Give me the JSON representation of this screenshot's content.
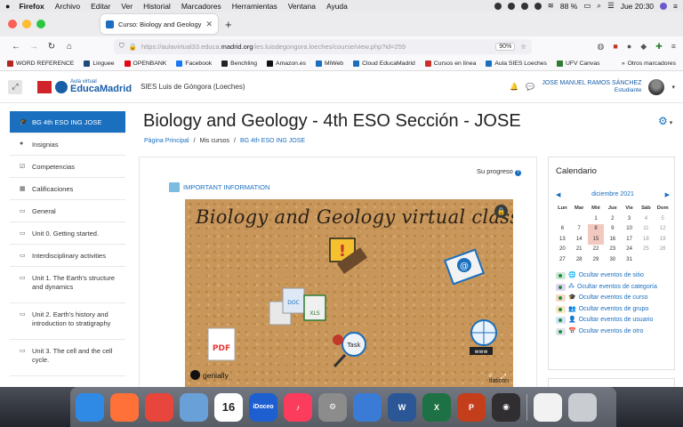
{
  "menubar": {
    "app": "Firefox",
    "items": [
      "Archivo",
      "Editar",
      "Ver",
      "Historial",
      "Marcadores",
      "Herramientas",
      "Ventana",
      "Ayuda"
    ],
    "battery": "88 %",
    "clock": "Jue 20:30"
  },
  "tab": {
    "title": "Curso: Biology and Geology - 4..."
  },
  "navbar": {
    "url_prefix": "https://aulavirtual33.educa.",
    "url_domain": "madrid.org",
    "url_suffix": "/ies.luisdegongora.loeches/course/view.php?id=259",
    "zoom": "90%"
  },
  "bookmarks": [
    {
      "label": "WORD REFERENCE",
      "color": "#b3261e"
    },
    {
      "label": "Linguee",
      "color": "#1e4a7a"
    },
    {
      "label": "OPENBANK",
      "color": "#e30613"
    },
    {
      "label": "Facebook",
      "color": "#1877f2"
    },
    {
      "label": "Benchling",
      "color": "#222222"
    },
    {
      "label": "Amazon.es",
      "color": "#111111"
    },
    {
      "label": "MiWeb",
      "color": "#1a6fbf"
    },
    {
      "label": "Cloud EducaMadrid",
      "color": "#1a6fbf"
    },
    {
      "label": "Cursos en línea",
      "color": "#c9302c"
    },
    {
      "label": "Aula SIES Loeches",
      "color": "#1a6fbf"
    },
    {
      "label": "UFV Canvas",
      "color": "#2e7d32"
    }
  ],
  "bookmarks_more": "Otros marcadores",
  "header": {
    "logo_small": "Aula virtual",
    "logo_big": "EducaMadrid",
    "school": "SIES Luis de Góngora (Loeches)",
    "user_name": "JOSE MANUEL RAMOS SÁNCHEZ",
    "user_role": "Estudiante"
  },
  "leftnav": [
    {
      "label": "BG 4th ESO ING JOSE",
      "icon": "graduation-cap-icon",
      "glyph": "🎓"
    },
    {
      "label": "Insignias",
      "icon": "badge-icon",
      "glyph": "●"
    },
    {
      "label": "Competencias",
      "icon": "check-icon",
      "glyph": "☑"
    },
    {
      "label": "Calificaciones",
      "icon": "table-icon",
      "glyph": "▦"
    },
    {
      "label": "General",
      "icon": "folder-icon",
      "glyph": "▭"
    },
    {
      "label": "Unit 0. Getting started.",
      "icon": "folder-icon",
      "glyph": "▭"
    },
    {
      "label": "Interdisciplinary activities",
      "icon": "folder-icon",
      "glyph": "▭"
    },
    {
      "label": "Unit 1. The Earth's structure and dynamics",
      "icon": "folder-icon",
      "glyph": "▭"
    },
    {
      "label": "Unit 2. Earth's history and introduction to stratigraphy",
      "icon": "folder-icon",
      "glyph": "▭"
    },
    {
      "label": "Unit 3. The cell and the cell cycle.",
      "icon": "folder-icon",
      "glyph": "▭"
    }
  ],
  "main": {
    "title": "Biology and Geology - 4th ESO Sección - JOSE",
    "breadcrumb": [
      "Página Principal",
      "Mis cursos",
      "BG 4th ESO ING JOSE"
    ],
    "progress": "Su progreso",
    "info_link": "IMPORTANT INFORMATION",
    "genially_title": "Biology and Geology virtual class",
    "genially_logo": "genially",
    "flaticon": "flaticon"
  },
  "calendar": {
    "title": "Calendario",
    "month": "diciembre 2021",
    "weekdays": [
      "Lun",
      "Mar",
      "Mié",
      "Jue",
      "Vie",
      "Sáb",
      "Dom"
    ],
    "weeks": [
      [
        "",
        "",
        "1",
        "2",
        "3",
        "4",
        "5"
      ],
      [
        "6",
        "7",
        "8",
        "9",
        "10",
        "11",
        "12"
      ],
      [
        "13",
        "14",
        "15",
        "16",
        "17",
        "18",
        "19"
      ],
      [
        "20",
        "21",
        "22",
        "23",
        "24",
        "25",
        "26"
      ],
      [
        "27",
        "28",
        "29",
        "30",
        "31",
        "",
        ""
      ]
    ],
    "highlighted": [
      "8",
      "15"
    ],
    "links": [
      {
        "label": "Ocultar eventos de sitio",
        "eye_color": "#cfe8d6",
        "glyph": "🌐"
      },
      {
        "label": "Ocultar eventos de categoría",
        "eye_color": "#e0d4f0",
        "glyph": "⁂"
      },
      {
        "label": "Ocultar eventos de curso",
        "eye_color": "#f6d8c4",
        "glyph": "🎓"
      },
      {
        "label": "Ocultar eventos de grupo",
        "eye_color": "#fbe5c4",
        "glyph": "👥"
      },
      {
        "label": "Ocultar eventos de usuario",
        "eye_color": "#d2e3f5",
        "glyph": "👤"
      },
      {
        "label": "Ocultar eventos de otro",
        "eye_color": "#dde3ea",
        "glyph": "📅"
      }
    ]
  },
  "dock": [
    {
      "name": "finder",
      "color": "#2f8ae6",
      "label": ""
    },
    {
      "name": "firefox",
      "color": "#ff7139",
      "label": ""
    },
    {
      "name": "chrome",
      "color": "#e8453c",
      "label": ""
    },
    {
      "name": "preview",
      "color": "#6aa0d8",
      "label": ""
    },
    {
      "name": "calendar",
      "color": "#ffffff",
      "label": "16"
    },
    {
      "name": "idoceo",
      "color": "#1d5fd0",
      "label": "iDoceo"
    },
    {
      "name": "music",
      "color": "#fb3c5c",
      "label": "♪"
    },
    {
      "name": "system-preferences",
      "color": "#8c8c8c",
      "label": "⚙"
    },
    {
      "name": "archive",
      "color": "#3a7bd5",
      "label": ""
    },
    {
      "name": "word",
      "color": "#2b5797",
      "label": "W"
    },
    {
      "name": "excel",
      "color": "#1e7145",
      "label": "X"
    },
    {
      "name": "powerpoint",
      "color": "#c43e1c",
      "label": "P"
    },
    {
      "name": "obs",
      "color": "#302e31",
      "label": "◉"
    },
    {
      "name": "document",
      "color": "#f2f2f2",
      "label": ""
    },
    {
      "name": "trash",
      "color": "#c9ccd1",
      "label": ""
    }
  ]
}
